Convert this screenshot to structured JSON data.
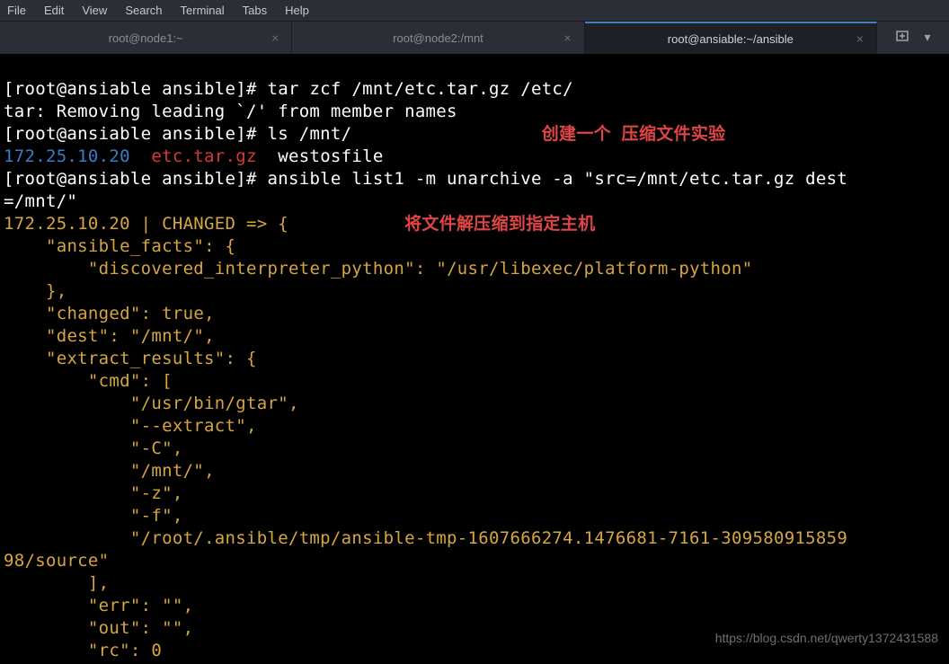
{
  "menubar": {
    "file": "File",
    "edit": "Edit",
    "view": "View",
    "search": "Search",
    "terminal": "Terminal",
    "tabs": "Tabs",
    "help": "Help"
  },
  "tabs": {
    "t0": "root@node1:~",
    "t1": "root@node2:/mnt",
    "t2": "root@ansiable:~/ansible",
    "close": "×"
  },
  "term": {
    "line1_prompt": "[root@ansiable ansible]# ",
    "line1_cmd": "tar zcf /mnt/etc.tar.gz /etc/",
    "line2": "tar: Removing leading `/' from member names",
    "line3_prompt": "[root@ansiable ansible]# ",
    "line3_cmd": "ls /mnt/",
    "line3_annot": "创建一个 压缩文件实验",
    "line4_ip": "172.25.10.20",
    "line4_tar": "etc.tar.gz",
    "line4_file": "westosfile",
    "line5_prompt": "[root@ansiable ansible]# ",
    "line5_cmd1": "ansible list1 -m unarchive -a ",
    "line5_cmd2": "\"src=/mnt/etc.tar.gz dest",
    "line6_cmd": "=/mnt/\"",
    "line7_ip": "172.25.10.20",
    "line7_status": " | CHANGED => {",
    "line7_annot": "将文件解压缩到指定主机",
    "j_af_key": "\"ansible_facts\"",
    "j_af_open": ": {",
    "j_dip_key": "\"discovered_interpreter_python\"",
    "j_dip_val": "\"/usr/libexec/platform-python\"",
    "j_close_brace": "},",
    "j_changed_key": "\"changed\"",
    "j_changed_val": "true",
    "j_dest_key": "\"dest\"",
    "j_dest_val": "\"/mnt/\"",
    "j_er_key": "\"extract_results\"",
    "j_er_open": ": {",
    "j_cmd_key": "\"cmd\"",
    "j_cmd_open": ": [",
    "j_cmd_v0": "\"/usr/bin/gtar\"",
    "j_cmd_v1": "\"--extract\"",
    "j_cmd_v2": "\"-C\"",
    "j_cmd_v3": "\"/mnt/\"",
    "j_cmd_v4": "\"-z\"",
    "j_cmd_v5": "\"-f\"",
    "j_cmd_v6a": "\"/root/.ansible/tmp/ansible-tmp-1607666274.1476681-7161-309580915859",
    "j_cmd_v6b": "98/source\"",
    "j_cmd_close": "],",
    "j_err_key": "\"err\"",
    "j_err_val": "\"\"",
    "j_out_key": "\"out\"",
    "j_out_val": "\"\"",
    "j_rc_key": "\"rc\"",
    "j_rc_val": "0",
    "comma": ",",
    "colon": ": "
  },
  "watermark": "https://blog.csdn.net/qwerty1372431588"
}
